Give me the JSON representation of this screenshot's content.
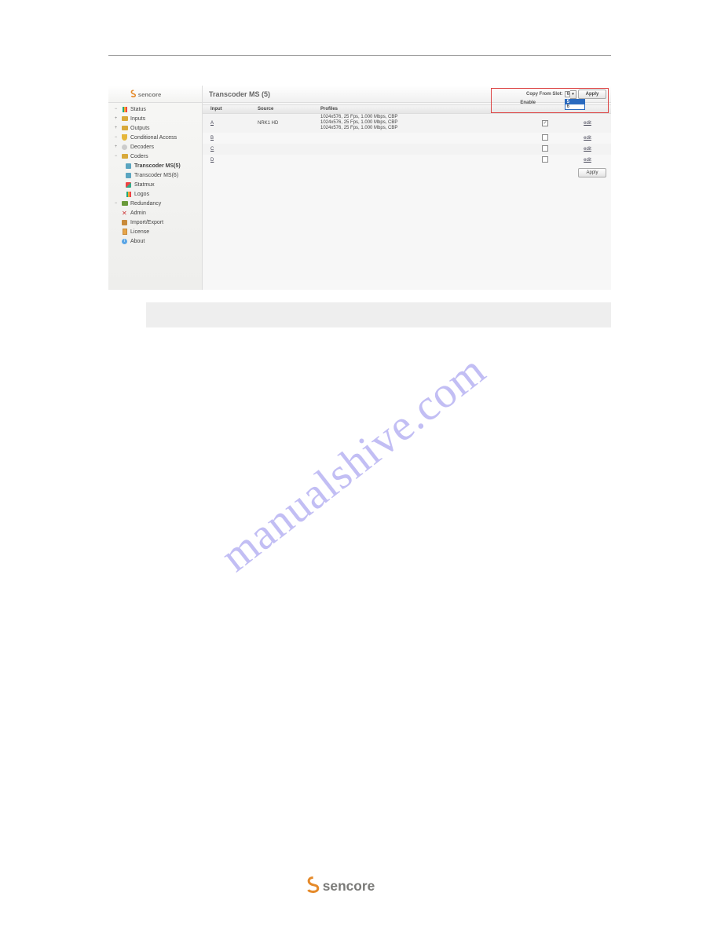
{
  "brand": "sencore",
  "sidebar": {
    "items": [
      {
        "label": "Status",
        "icon": "bar",
        "expander": "−"
      },
      {
        "label": "Inputs",
        "icon": "folder-yellow",
        "expander": "+"
      },
      {
        "label": "Outputs",
        "icon": "folder-yellow",
        "expander": "+"
      },
      {
        "label": "Conditional Access",
        "icon": "shield",
        "expander": "−"
      },
      {
        "label": "Decoders",
        "icon": "disc",
        "expander": "+"
      },
      {
        "label": "Coders",
        "icon": "folder-yellow",
        "expander": "−"
      },
      {
        "label": "Transcoder MS(5)",
        "icon": "sq-cyan",
        "indent": true,
        "bold": true
      },
      {
        "label": "Transcoder MS(6)",
        "icon": "sq-cyan",
        "indent": true
      },
      {
        "label": "Statmux",
        "icon": "sq-multi",
        "indent": true
      },
      {
        "label": "Logos",
        "icon": "bar",
        "indent": true
      },
      {
        "label": "Redundancy",
        "icon": "folder-green",
        "expander": "−"
      },
      {
        "label": "Admin",
        "icon": "x"
      },
      {
        "label": "Import/Export",
        "icon": "pkg"
      },
      {
        "label": "License",
        "icon": "doc"
      },
      {
        "label": "About",
        "icon": "info"
      }
    ]
  },
  "main": {
    "title": "Transcoder MS (5)",
    "copy_label": "Copy From Slot:",
    "enable_header": "Enable",
    "slot_selected": "6",
    "slot_options": [
      "5",
      "6"
    ],
    "apply_label": "Apply",
    "columns": {
      "input": "Input",
      "source": "Source",
      "profiles": "Profiles"
    },
    "rows": [
      {
        "input": "A",
        "source": "NRK1 HD",
        "profiles": [
          "1024x576, 25 Fps, 1.000 Mbps, CBP",
          "1024x576, 25 Fps, 1.000 Mbps, CBP",
          "1024x576, 25 Fps, 1.000 Mbps, CBP"
        ],
        "enabled": true,
        "edit": "edit"
      },
      {
        "input": "B",
        "source": "",
        "profiles": [],
        "enabled": false,
        "edit": "edit"
      },
      {
        "input": "C",
        "source": "",
        "profiles": [],
        "enabled": false,
        "edit": "edit"
      },
      {
        "input": "D",
        "source": "",
        "profiles": [],
        "enabled": false,
        "edit": "edit"
      }
    ]
  },
  "watermark": "manualshive.com"
}
